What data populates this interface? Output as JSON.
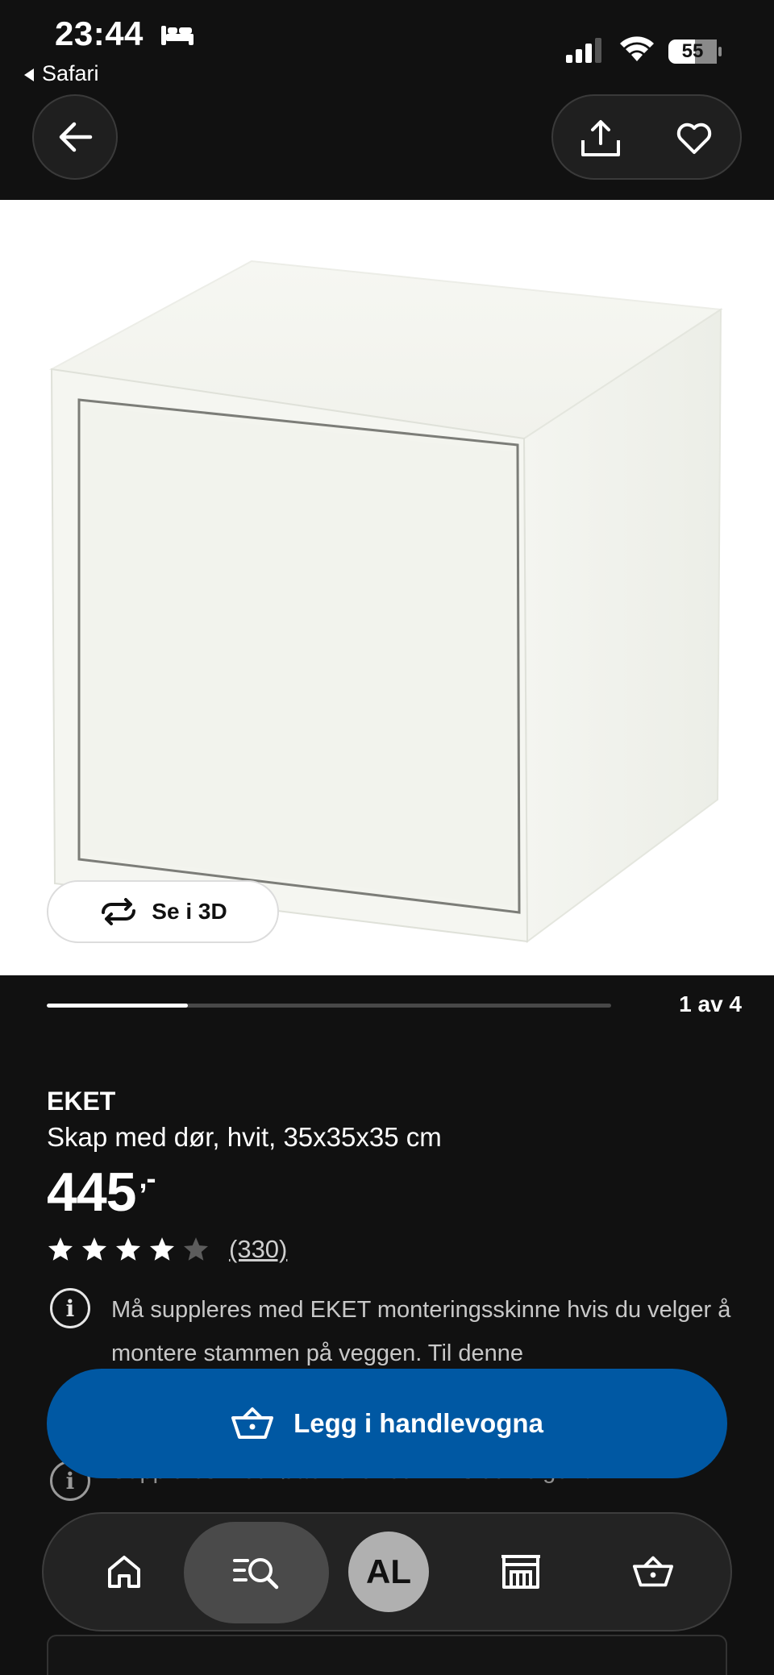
{
  "status_bar": {
    "time": "23:44",
    "back_app": "Safari",
    "battery": "55"
  },
  "icons": {
    "back": "arrow-left-icon",
    "share": "share-icon",
    "favorite": "heart-icon",
    "rotate": "rotate-3d-icon",
    "info": "info-icon",
    "cart": "basket-icon",
    "home": "home-icon",
    "search": "search-icon",
    "store": "store-icon"
  },
  "gallery": {
    "view_3d_label": "Se i 3D",
    "counter": "1 av 4",
    "progress": 0.25
  },
  "product": {
    "brand": "EKET",
    "description": "Skap med dør, hvit, 35x35x35 cm",
    "price": "445",
    "price_suffix": ",-",
    "rating": 4,
    "rating_max": 5,
    "reviews_count": "(330)"
  },
  "notices": [
    {
      "text": "Må suppleres med EKET monteringsskinne hvis du velger å montere stammen på veggen. Til denne"
    },
    {
      "text": "Suppleres med føtter eller ben hvis du velger å"
    }
  ],
  "cart_button": {
    "label": "Legg i handlevogna"
  },
  "bottom_nav": {
    "avatar_initials": "AL"
  },
  "colors": {
    "background": "#111111",
    "primary_blue": "#0058a3",
    "text": "#ffffff"
  }
}
